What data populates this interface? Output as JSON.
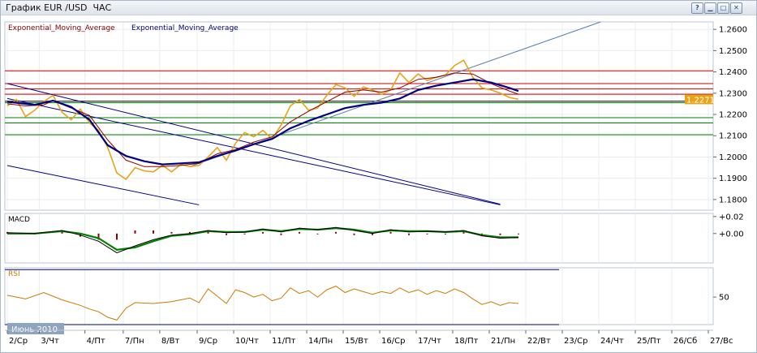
{
  "window": {
    "title": "График EUR /USD  ЧАС",
    "buttons": [
      {
        "name": "help-button",
        "glyph": "?"
      },
      {
        "name": "minimize-button",
        "glyph": "▁"
      },
      {
        "name": "maximize-button",
        "glyph": "□"
      },
      {
        "name": "close-button",
        "glyph": "✕"
      }
    ]
  },
  "chart_data": {
    "type": "line",
    "panels": [
      {
        "id": "price",
        "legend": [
          "Exponential_Moving_Average",
          "Exponential_Moving_Average"
        ],
        "legend_colors": [
          "#8b0000",
          "#000080"
        ],
        "ylim": [
          1.175,
          1.2635
        ],
        "yticks": [
          "1.2600",
          "1.2500",
          "1.2400",
          "1.2300",
          "1.2200",
          "1.2100",
          "1.2000",
          "1.1900",
          "1.1800"
        ],
        "current_price": "1.2271",
        "price_color": "#e8a317",
        "ema_fast_color": "#8b0000",
        "ema_slow_color": "#000080",
        "price_series": [
          [
            0,
            1.224
          ],
          [
            1,
            1.227
          ],
          [
            2,
            1.219
          ],
          [
            3,
            1.222
          ],
          [
            4,
            1.226
          ],
          [
            5,
            1.229
          ],
          [
            6,
            1.221
          ],
          [
            7,
            1.2175
          ],
          [
            8,
            1.2225
          ],
          [
            9,
            1.216
          ],
          [
            10,
            1.2125
          ],
          [
            11,
            1.2045
          ],
          [
            12,
            1.1925
          ],
          [
            13,
            1.1895
          ],
          [
            14,
            1.195
          ],
          [
            15,
            1.1935
          ],
          [
            16,
            1.193
          ],
          [
            17,
            1.196
          ],
          [
            18,
            1.193
          ],
          [
            19,
            1.1965
          ],
          [
            20,
            1.1955
          ],
          [
            21,
            1.196
          ],
          [
            22,
            1.2
          ],
          [
            23,
            1.2045
          ],
          [
            24,
            1.1985
          ],
          [
            25,
            1.2065
          ],
          [
            26,
            1.2115
          ],
          [
            27,
            1.2095
          ],
          [
            28,
            1.2125
          ],
          [
            29,
            1.2085
          ],
          [
            30,
            1.215
          ],
          [
            31,
            1.224
          ],
          [
            32,
            1.227
          ],
          [
            33,
            1.222
          ],
          [
            34,
            1.223
          ],
          [
            35,
            1.229
          ],
          [
            36,
            1.234
          ],
          [
            37,
            1.2325
          ],
          [
            38,
            1.2285
          ],
          [
            39,
            1.233
          ],
          [
            40,
            1.2315
          ],
          [
            41,
            1.2295
          ],
          [
            42,
            1.2315
          ],
          [
            43,
            1.2395
          ],
          [
            44,
            1.235
          ],
          [
            45,
            1.239
          ],
          [
            46,
            1.236
          ],
          [
            47,
            1.2375
          ],
          [
            48,
            1.2385
          ],
          [
            49,
            1.243
          ],
          [
            50,
            1.2455
          ],
          [
            51,
            1.2375
          ],
          [
            52,
            1.2325
          ],
          [
            53,
            1.2315
          ],
          [
            54,
            1.23
          ],
          [
            55,
            1.228
          ],
          [
            56,
            1.2271
          ]
        ],
        "ema_fast_series": [
          [
            0,
            1.225
          ],
          [
            2,
            1.224
          ],
          [
            4,
            1.2245
          ],
          [
            5,
            1.2265
          ],
          [
            7,
            1.223
          ],
          [
            9,
            1.2195
          ],
          [
            11,
            1.208
          ],
          [
            13,
            1.1985
          ],
          [
            15,
            1.1955
          ],
          [
            17,
            1.1955
          ],
          [
            19,
            1.196
          ],
          [
            21,
            1.197
          ],
          [
            23,
            1.2015
          ],
          [
            25,
            1.2035
          ],
          [
            27,
            1.207
          ],
          [
            29,
            1.2095
          ],
          [
            31,
            1.2165
          ],
          [
            33,
            1.2215
          ],
          [
            35,
            1.226
          ],
          [
            37,
            1.2305
          ],
          [
            39,
            1.2315
          ],
          [
            41,
            1.2305
          ],
          [
            43,
            1.2325
          ],
          [
            45,
            1.2365
          ],
          [
            47,
            1.2375
          ],
          [
            49,
            1.2395
          ],
          [
            51,
            1.239
          ],
          [
            53,
            1.2345
          ],
          [
            55,
            1.231
          ],
          [
            56,
            1.2295
          ]
        ],
        "ema_slow_series": [
          [
            0,
            1.226
          ],
          [
            1,
            1.2255
          ],
          [
            3,
            1.2245
          ],
          [
            5,
            1.2265
          ],
          [
            7,
            1.2235
          ],
          [
            9,
            1.2175
          ],
          [
            11,
            1.2055
          ],
          [
            13,
            1.2005
          ],
          [
            15,
            1.198
          ],
          [
            17,
            1.1965
          ],
          [
            19,
            1.197
          ],
          [
            21,
            1.1975
          ],
          [
            23,
            1.2005
          ],
          [
            25,
            1.203
          ],
          [
            27,
            1.206
          ],
          [
            29,
            1.2085
          ],
          [
            31,
            1.2135
          ],
          [
            33,
            1.217
          ],
          [
            35,
            1.22
          ],
          [
            37,
            1.223
          ],
          [
            39,
            1.2245
          ],
          [
            41,
            1.2255
          ],
          [
            43,
            1.2275
          ],
          [
            45,
            1.2315
          ],
          [
            47,
            1.2335
          ],
          [
            49,
            1.235
          ],
          [
            51,
            1.2365
          ],
          [
            53,
            1.235
          ],
          [
            55,
            1.2325
          ],
          [
            56,
            1.231
          ]
        ],
        "hlines": [
          {
            "y": 1.2405,
            "color": "#cc0000"
          },
          {
            "y": 1.2345,
            "color": "#cc0000"
          },
          {
            "y": 1.232,
            "color": "#cc0000"
          },
          {
            "y": 1.2295,
            "color": "#cc0000"
          },
          {
            "y": 1.2262,
            "color": "#000000"
          },
          {
            "y": 1.2255,
            "color": "#008000"
          },
          {
            "y": 1.2185,
            "color": "#008000"
          },
          {
            "y": 1.216,
            "color": "#008000"
          },
          {
            "y": 1.2105,
            "color": "#008000"
          }
        ],
        "trendlines": [
          {
            "from": [
              0,
              1.2345
            ],
            "to": [
              54,
              1.1778
            ],
            "color": "#000080"
          },
          {
            "from": [
              0,
              1.2275
            ],
            "to": [
              54,
              1.1775
            ],
            "color": "#000080"
          },
          {
            "from": [
              0,
              1.196
            ],
            "to": [
              21,
              1.1775
            ],
            "color": "#000080"
          },
          {
            "from": [
              20,
              1.1955
            ],
            "to": [
              65,
              1.2635
            ],
            "color": "#5b7ea6"
          }
        ]
      },
      {
        "id": "macd",
        "title": "MACD",
        "ylim": [
          -0.019,
          0.013
        ],
        "yticks": [
          "+0.02",
          "+0.00"
        ],
        "ytick_values": [
          0.011,
          0.0
        ],
        "macd_color": "#000000",
        "signal_color": "#008000",
        "hist_color": "#8b0000",
        "macd_series": [
          [
            0,
            0.0005
          ],
          [
            3,
            0.0
          ],
          [
            6,
            0.002
          ],
          [
            8,
            -0.001
          ],
          [
            10,
            -0.005
          ],
          [
            12,
            -0.0125
          ],
          [
            14,
            -0.008
          ],
          [
            16,
            -0.004
          ],
          [
            18,
            -0.001
          ],
          [
            20,
            0.0
          ],
          [
            22,
            0.002
          ],
          [
            24,
            0.0005
          ],
          [
            26,
            0.001
          ],
          [
            28,
            0.003
          ],
          [
            30,
            0.001
          ],
          [
            32,
            0.0035
          ],
          [
            34,
            0.0025
          ],
          [
            36,
            0.004
          ],
          [
            38,
            0.002
          ],
          [
            40,
            0.0
          ],
          [
            42,
            0.0025
          ],
          [
            44,
            0.001
          ],
          [
            46,
            0.0015
          ],
          [
            48,
            0.001
          ],
          [
            50,
            0.002
          ],
          [
            52,
            -0.0015
          ],
          [
            54,
            -0.003
          ],
          [
            56,
            -0.0025
          ]
        ],
        "signal_series": [
          [
            0,
            0.0
          ],
          [
            3,
            0.0
          ],
          [
            6,
            0.0015
          ],
          [
            8,
            0.0
          ],
          [
            10,
            -0.003
          ],
          [
            12,
            -0.0105
          ],
          [
            14,
            -0.009
          ],
          [
            16,
            -0.005
          ],
          [
            18,
            -0.0015
          ],
          [
            20,
            -0.0005
          ],
          [
            22,
            0.0015
          ],
          [
            24,
            0.001
          ],
          [
            26,
            0.001
          ],
          [
            28,
            0.0025
          ],
          [
            30,
            0.0015
          ],
          [
            32,
            0.003
          ],
          [
            34,
            0.0025
          ],
          [
            36,
            0.0035
          ],
          [
            38,
            0.0025
          ],
          [
            40,
            0.0005
          ],
          [
            42,
            0.002
          ],
          [
            44,
            0.0015
          ],
          [
            46,
            0.0015
          ],
          [
            48,
            0.001
          ],
          [
            50,
            0.0015
          ],
          [
            52,
            -0.001
          ],
          [
            54,
            -0.0025
          ],
          [
            56,
            -0.0025
          ]
        ]
      },
      {
        "id": "rsi",
        "title": "RSI",
        "ylim": [
          20,
          82
        ],
        "yticks": [
          "50"
        ],
        "ytick_values": [
          50
        ],
        "levels": [
          {
            "y": 80,
            "color": "#000080"
          },
          {
            "y": 20,
            "color": "#000080"
          }
        ],
        "rsi_color": "#cc7a00",
        "rsi_series": [
          [
            0,
            52
          ],
          [
            2,
            48
          ],
          [
            4,
            55
          ],
          [
            6,
            47
          ],
          [
            8,
            41
          ],
          [
            9,
            37
          ],
          [
            10,
            34
          ],
          [
            11,
            28
          ],
          [
            12,
            25
          ],
          [
            13,
            38
          ],
          [
            14,
            44
          ],
          [
            16,
            43
          ],
          [
            18,
            45
          ],
          [
            20,
            49
          ],
          [
            21,
            44
          ],
          [
            22,
            59
          ],
          [
            23,
            51
          ],
          [
            24,
            43
          ],
          [
            25,
            58
          ],
          [
            26,
            55
          ],
          [
            27,
            50
          ],
          [
            28,
            53
          ],
          [
            29,
            46
          ],
          [
            30,
            49
          ],
          [
            31,
            60
          ],
          [
            32,
            54
          ],
          [
            33,
            57
          ],
          [
            34,
            50
          ],
          [
            35,
            58
          ],
          [
            36,
            62
          ],
          [
            37,
            55
          ],
          [
            38,
            59
          ],
          [
            39,
            56
          ],
          [
            40,
            53
          ],
          [
            41,
            56
          ],
          [
            42,
            54
          ],
          [
            43,
            60
          ],
          [
            44,
            55
          ],
          [
            45,
            58
          ],
          [
            46,
            53
          ],
          [
            47,
            57
          ],
          [
            48,
            54
          ],
          [
            49,
            59
          ],
          [
            50,
            55
          ],
          [
            51,
            48
          ],
          [
            52,
            42
          ],
          [
            53,
            45
          ],
          [
            54,
            41
          ],
          [
            55,
            44
          ],
          [
            56,
            43
          ]
        ]
      }
    ],
    "x_axis": {
      "n": 57,
      "ticks": [
        {
          "label": "2/Ср",
          "x": 0
        },
        {
          "label": "3/Чт",
          "x": 3.5
        },
        {
          "label": "4/Пт",
          "x": 8.5
        },
        {
          "label": "7/Пн",
          "x": 12.7
        },
        {
          "label": "8/Вт",
          "x": 16.7
        },
        {
          "label": "9/Ср",
          "x": 20.8
        },
        {
          "label": "10/Чт",
          "x": 24.8
        },
        {
          "label": "11/Пт",
          "x": 28.8
        },
        {
          "label": "14/Пн",
          "x": 32.8
        },
        {
          "label": "15/Вт",
          "x": 36.8
        },
        {
          "label": "16/Ср",
          "x": 40.8
        },
        {
          "label": "17/Чт",
          "x": 44.8
        },
        {
          "label": "18/Пт",
          "x": 48.8
        },
        {
          "label": "21/Пн",
          "x": 52.8
        },
        {
          "label": "22/Вт",
          "x": 56.8
        },
        {
          "label": "23/Ср",
          "x": 60.8
        },
        {
          "label": "24/Чт",
          "x": 64.8
        },
        {
          "label": "25/Пт",
          "x": 68.8
        },
        {
          "label": "26/Сб",
          "x": 72.8
        },
        {
          "label": "27/Вс",
          "x": 76.8
        }
      ]
    },
    "period_label": "Июнь 2010",
    "grid": true
  }
}
